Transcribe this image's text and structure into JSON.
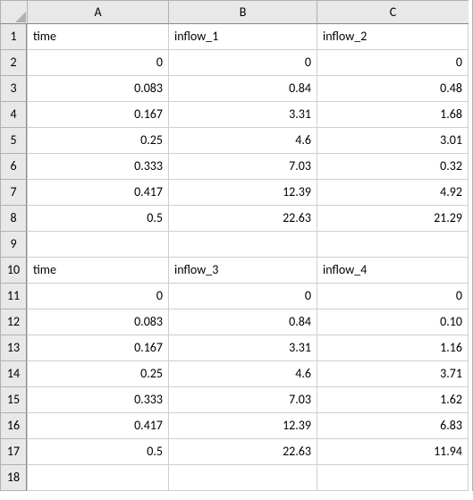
{
  "columns": [
    "A",
    "B",
    "C"
  ],
  "rows": [
    "1",
    "2",
    "3",
    "4",
    "5",
    "6",
    "7",
    "8",
    "9",
    "10",
    "11",
    "12",
    "13",
    "14",
    "15",
    "16",
    "17",
    "18"
  ],
  "cells": {
    "A1": "time",
    "B1": "inflow_1",
    "C1": "inflow_2",
    "A2": "0",
    "B2": "0",
    "C2": "0",
    "A3": "0.083",
    "B3": "0.84",
    "C3": "0.48",
    "A4": "0.167",
    "B4": "3.31",
    "C4": "1.68",
    "A5": "0.25",
    "B5": "4.6",
    "C5": "3.01",
    "A6": "0.333",
    "B6": "7.03",
    "C6": "0.32",
    "A7": "0.417",
    "B7": "12.39",
    "C7": "4.92",
    "A8": "0.5",
    "B8": "22.63",
    "C8": "21.29",
    "A9": "",
    "B9": "",
    "C9": "",
    "A10": "time",
    "B10": "inflow_3",
    "C10": "inflow_4",
    "A11": "0",
    "B11": "0",
    "C11": "0",
    "A12": "0.083",
    "B12": "0.84",
    "C12": "0.10",
    "A13": "0.167",
    "B13": "3.31",
    "C13": "1.16",
    "A14": "0.25",
    "B14": "4.6",
    "C14": "3.71",
    "A15": "0.333",
    "B15": "7.03",
    "C15": "1.62",
    "A16": "0.417",
    "B16": "12.39",
    "C16": "6.83",
    "A17": "0.5",
    "B17": "22.63",
    "C17": "11.94",
    "A18": "",
    "B18": "",
    "C18": ""
  },
  "text_cells": [
    "A1",
    "B1",
    "C1",
    "A10",
    "B10",
    "C10"
  ]
}
